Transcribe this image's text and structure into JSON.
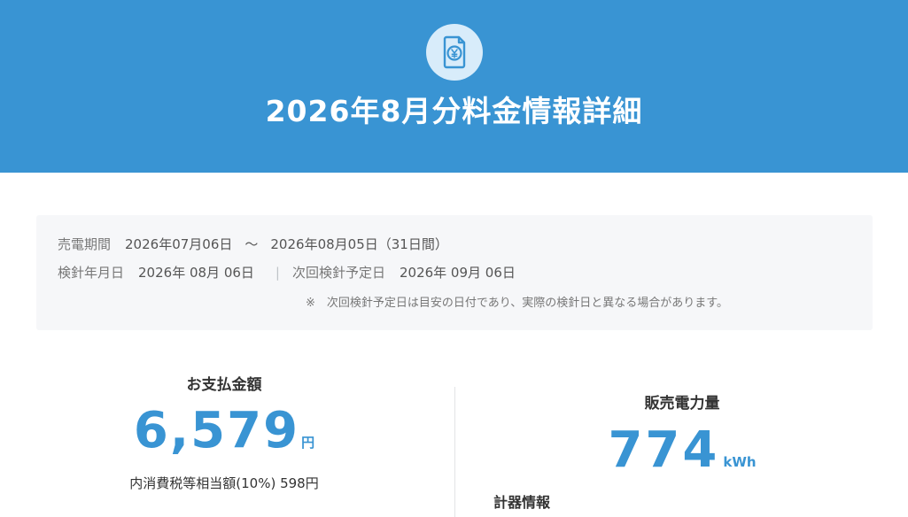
{
  "header": {
    "icon": "yen-document-icon",
    "title": "2026年8月分料金情報詳細",
    "bg_color": "#3994d3"
  },
  "info": {
    "sale_period_label": "売電期間",
    "sale_period_start": "2026年07月06日",
    "tilde": "～",
    "sale_period_end": "2026年08月05日（31日間）",
    "reading_date_label": "検針年月日",
    "reading_date": "2026年 08月 06日",
    "separator": "|",
    "next_reading_label": "次回検針予定日",
    "next_reading_date": "2026年 09月 06日",
    "note": "※　次回検針予定日は目安の日付であり、実際の検針日と異なる場合があります。"
  },
  "payment": {
    "label": "お支払金額",
    "amount": "6,579",
    "unit": "円",
    "tax_text": "内消費税等相当額(10%) 598円"
  },
  "power": {
    "label": "販売電力量",
    "amount": "774",
    "unit": "kWh"
  },
  "meter": {
    "title": "計器情報"
  },
  "colors": {
    "accent": "#3994d3",
    "info_bg": "#f6f7f9"
  }
}
